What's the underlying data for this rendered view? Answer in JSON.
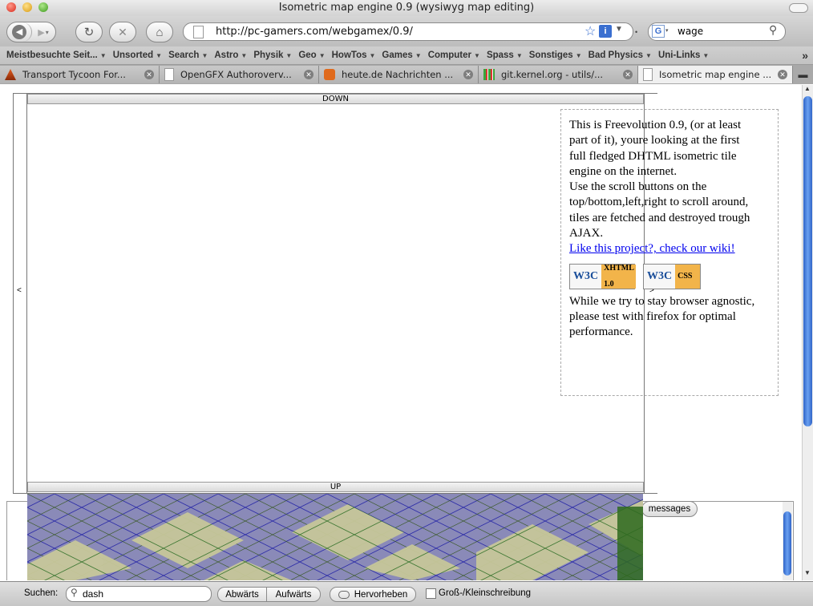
{
  "window": {
    "title": "Isometric map engine 0.9 (wysiwyg map editing)"
  },
  "nav": {
    "url": "http://pc-gamers.com/webgamex/0.9/",
    "search_value": "wage",
    "search_engine_icon": "G"
  },
  "bookmarks": [
    {
      "label": "Meistbesuchte Seit..."
    },
    {
      "label": "Unsorted"
    },
    {
      "label": "Search"
    },
    {
      "label": "Astro"
    },
    {
      "label": "Physik"
    },
    {
      "label": "Geo"
    },
    {
      "label": "HowTos"
    },
    {
      "label": "Games"
    },
    {
      "label": "Computer"
    },
    {
      "label": "Spass"
    },
    {
      "label": "Sonstiges"
    },
    {
      "label": "Bad Physics"
    },
    {
      "label": "Uni-Links"
    }
  ],
  "bookmarks_overflow": "»",
  "tabs": [
    {
      "label": "Transport Tycoon For...",
      "favicon": "tt-icon"
    },
    {
      "label": "OpenGFX Authoroverv...",
      "favicon": "page-icon"
    },
    {
      "label": "heute.de Nachrichten ...",
      "favicon": "zdf-icon"
    },
    {
      "label": "git.kernel.org - utils/...",
      "favicon": "git-icon"
    },
    {
      "label": "Isometric map engine ...",
      "favicon": "page-icon",
      "active": true
    }
  ],
  "map": {
    "top_scroll_label": "DOWN",
    "bottom_scroll_label": "UP",
    "left_arrow": "<",
    "right_arrow": ">"
  },
  "info": {
    "line1": "This is Freevo",
    "line1_rest": "lution 0.9, (or at least",
    "line2": "part of it), you",
    "line2_rest": "re looking at the first",
    "line3": "full fledged DH",
    "line3_rest": "TML isometric tile",
    "line4": "engine on the i",
    "line4_rest": "nternet.",
    "line5": "Use the scroll b",
    "line5_rest": "uttons on the",
    "line6": "top/bottom,left,",
    "line6_rest": "right to scroll around,",
    "line7": "tiles are fetche",
    "line7_rest": "d and destroyed trough",
    "line8": "AJAX.",
    "link": "Like this proje",
    "link_rest": "ct?, check our wiki!",
    "badge_xhtml": "XHTML 1.0",
    "badge_css": "CSS",
    "w3c": "W3C",
    "outro1": "While we try t",
    "outro1_rest": "o stay browser agnostic,",
    "outro2": "please test wit",
    "outro2_rest": "h firefox for optimal",
    "outro3": "performance."
  },
  "lower": {
    "messages_button": "messages"
  },
  "findbar": {
    "label": "Suchen:",
    "value": "dash",
    "prev": "Abwärts",
    "next": "Aufwärts",
    "highlight": "Hervorheben",
    "match_case": "Groß-/Kleinschreibung"
  }
}
